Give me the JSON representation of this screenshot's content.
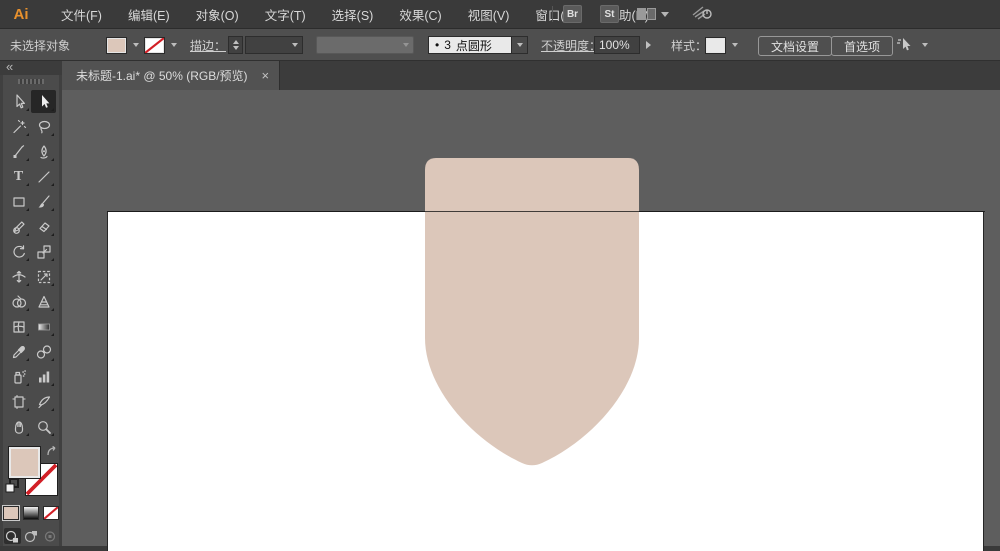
{
  "app": {
    "logo_text": "Ai"
  },
  "menu_bar": {
    "items": [
      "文件(F)",
      "编辑(E)",
      "对象(O)",
      "文字(T)",
      "选择(S)",
      "效果(C)",
      "视图(V)",
      "窗口(W)",
      "帮助(H)"
    ],
    "bridge_button": "Br",
    "stock_button": "St"
  },
  "control_bar": {
    "selection_status": "未选择对象",
    "stroke_label": "描边：",
    "brush_bullet": "•",
    "brush_size": "3",
    "brush_name": "点圆形",
    "opacity_label": "不透明度：",
    "opacity_value": "100%",
    "style_label": "样式：",
    "document_setup_button": "文档设置",
    "preferences_button": "首选项"
  },
  "tab": {
    "title": "未标题-1.ai* @ 50% (RGB/预览)",
    "close_glyph": "×"
  },
  "toolbar": {
    "collapse_glyph": "«",
    "active_tool": "direct-selection-tool",
    "tools": [
      "selection-tool",
      "direct-selection-tool",
      "magic-wand-tool",
      "lasso-tool",
      "pen-tool",
      "curvature-tool",
      "type-tool",
      "line-segment-tool",
      "rectangle-tool",
      "paintbrush-tool",
      "pencil-tool",
      "eraser-tool",
      "rotate-tool",
      "scale-tool",
      "width-tool",
      "free-transform-tool",
      "shape-builder-tool",
      "perspective-grid-tool",
      "mesh-tool",
      "gradient-tool",
      "eyedropper-tool",
      "blend-tool",
      "symbol-sprayer-tool",
      "column-graph-tool",
      "artboard-tool",
      "slice-tool",
      "hand-tool",
      "zoom-tool"
    ]
  },
  "colors": {
    "shape_fill": "#dcc7ba",
    "none_red": "#d21f26",
    "logo_orange": "#e8912d"
  }
}
